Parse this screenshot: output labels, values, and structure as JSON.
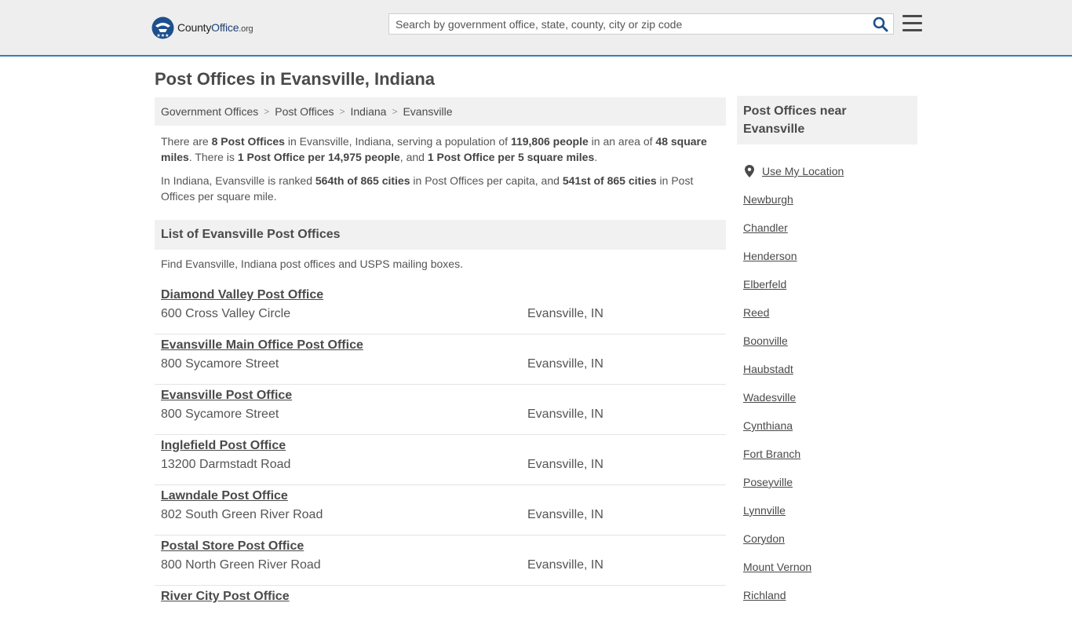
{
  "header": {
    "logo_county": "County",
    "logo_office": "Office",
    "logo_org": ".org",
    "search_placeholder": "Search by government office, state, county, city or zip code",
    "icons": {
      "logo": "seal-stars-icon",
      "search": "search-icon",
      "menu": "hamburger-menu-icon"
    },
    "accent_color": "#3b7bbf"
  },
  "page": {
    "title": "Post Offices in Evansville, Indiana"
  },
  "breadcrumbs": [
    "Government Offices",
    "Post Offices",
    "Indiana",
    "Evansville"
  ],
  "summary": {
    "p1": {
      "t1": "There are ",
      "b1": "8 Post Offices",
      "t2": " in Evansville, Indiana, serving a population of ",
      "b2": "119,806 people",
      "t3": " in an area of ",
      "b3": "48 square miles",
      "t4": ". There is ",
      "b4": "1 Post Office per 14,975 people",
      "t5": ", and ",
      "b5": "1 Post Office per 5 square miles",
      "t6": "."
    },
    "p2": {
      "t1": "In Indiana, Evansville is ranked ",
      "b1": "564th of 865 cities",
      "t2": " in Post Offices per capita, and ",
      "b2": "541st of 865 cities",
      "t3": " in Post Offices per square mile."
    }
  },
  "list": {
    "heading": "List of Evansville Post Offices",
    "intro": "Find Evansville, Indiana post offices and USPS mailing boxes.",
    "items": [
      {
        "name": "Diamond Valley Post Office",
        "address": "600 Cross Valley Circle",
        "city": "Evansville, IN"
      },
      {
        "name": "Evansville Main Office Post Office",
        "address": "800 Sycamore Street",
        "city": "Evansville, IN"
      },
      {
        "name": "Evansville Post Office",
        "address": "800 Sycamore Street",
        "city": "Evansville, IN"
      },
      {
        "name": "Inglefield Post Office",
        "address": "13200 Darmstadt Road",
        "city": "Evansville, IN"
      },
      {
        "name": "Lawndale Post Office",
        "address": "802 South Green River Road",
        "city": "Evansville, IN"
      },
      {
        "name": "Postal Store Post Office",
        "address": "800 North Green River Road",
        "city": "Evansville, IN"
      },
      {
        "name": "River City Post Office",
        "address": "",
        "city": ""
      }
    ]
  },
  "sidebar": {
    "heading": "Post Offices near Evansville",
    "use_location": "Use My Location",
    "location_icon": "map-pin-icon",
    "cities": [
      "Newburgh",
      "Chandler",
      "Henderson",
      "Elberfeld",
      "Reed",
      "Boonville",
      "Haubstadt",
      "Wadesville",
      "Cynthiana",
      "Fort Branch",
      "Poseyville",
      "Lynnville",
      "Corydon",
      "Mount Vernon",
      "Richland"
    ]
  }
}
